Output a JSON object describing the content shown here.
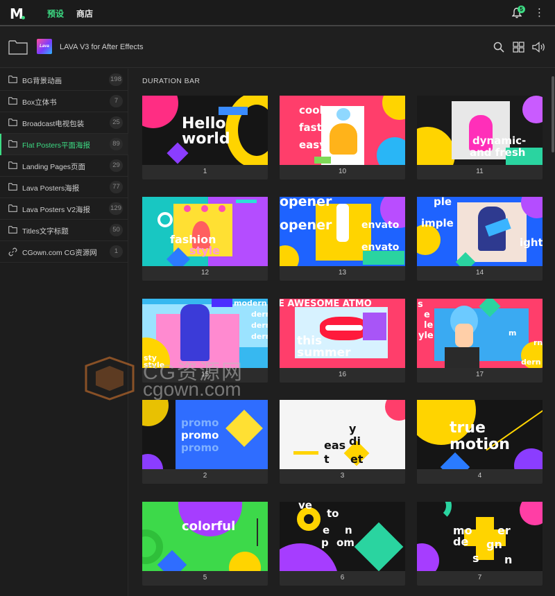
{
  "topbar": {
    "logo_letter": "M",
    "tabs": [
      {
        "label": "预设",
        "active": true
      },
      {
        "label": "商店",
        "active": false
      }
    ],
    "notification_count": "5",
    "more_icon": "⋮"
  },
  "project": {
    "thumb_label": "Lava",
    "title": "LAVA V3 for After Effects"
  },
  "sidebar": {
    "items": [
      {
        "label": "BG背景动画",
        "count": "198",
        "icon": "folder-icon"
      },
      {
        "label": "Box立体书",
        "count": "7",
        "icon": "folder-icon"
      },
      {
        "label": "Broadcast电视包装",
        "count": "25",
        "icon": "folder-icon"
      },
      {
        "label": "Flat Posters平面海报",
        "count": "89",
        "icon": "folder-icon"
      },
      {
        "label": "Landing Pages页面",
        "count": "29",
        "icon": "folder-icon"
      },
      {
        "label": "Lava Posters海报",
        "count": "77",
        "icon": "folder-icon"
      },
      {
        "label": "Lava Posters V2海报",
        "count": "129",
        "icon": "folder-icon"
      },
      {
        "label": "Titles文字标题",
        "count": "50",
        "icon": "folder-icon"
      },
      {
        "label": "CGown.com CG资源网",
        "count": "1",
        "icon": "link-icon"
      }
    ],
    "active_index": 3
  },
  "main": {
    "section_title": "DURATION BAR",
    "cards": [
      {
        "number": "1",
        "texts": [
          "Hello",
          "world"
        ]
      },
      {
        "number": "10",
        "texts": [
          "cool",
          "fast",
          "easy"
        ]
      },
      {
        "number": "11",
        "texts": [
          "dynamic-",
          "and fresh"
        ]
      },
      {
        "number": "12",
        "texts": [
          "fashion",
          "style"
        ]
      },
      {
        "number": "13",
        "texts": [
          "opener",
          "opener",
          "envato",
          "envato"
        ]
      },
      {
        "number": "14",
        "texts": [
          "ple",
          "imple",
          "ight"
        ]
      },
      {
        "number": "15",
        "texts": [
          "modern",
          "dern",
          "dern",
          "dern",
          "sty",
          "style"
        ]
      },
      {
        "number": "16",
        "texts": [
          "E AWESOME ATMO",
          "this",
          "summer"
        ]
      },
      {
        "number": "17",
        "texts": [
          "s",
          "e",
          "le",
          "yle",
          "m",
          "rn",
          "dern"
        ]
      },
      {
        "number": "2",
        "texts": [
          "promo",
          "promo",
          "promo"
        ]
      },
      {
        "number": "3",
        "texts": [
          "y",
          "di",
          "eas",
          "t",
          "et"
        ]
      },
      {
        "number": "4",
        "texts": [
          "true",
          "motion"
        ]
      },
      {
        "number": "5",
        "texts": [
          "colorful"
        ]
      },
      {
        "number": "6",
        "texts": [
          "ve",
          "to",
          "e",
          "n",
          "p",
          "om"
        ]
      },
      {
        "number": "7",
        "texts": [
          "mo",
          "er",
          "de",
          "gn",
          "s",
          "n"
        ]
      }
    ]
  },
  "watermark": {
    "line1": "CG资源网",
    "line2": "cgown.com"
  },
  "colors": {
    "accent": "#3ddc84",
    "background": "#1f1f1f",
    "card": "#2c2c2c"
  }
}
